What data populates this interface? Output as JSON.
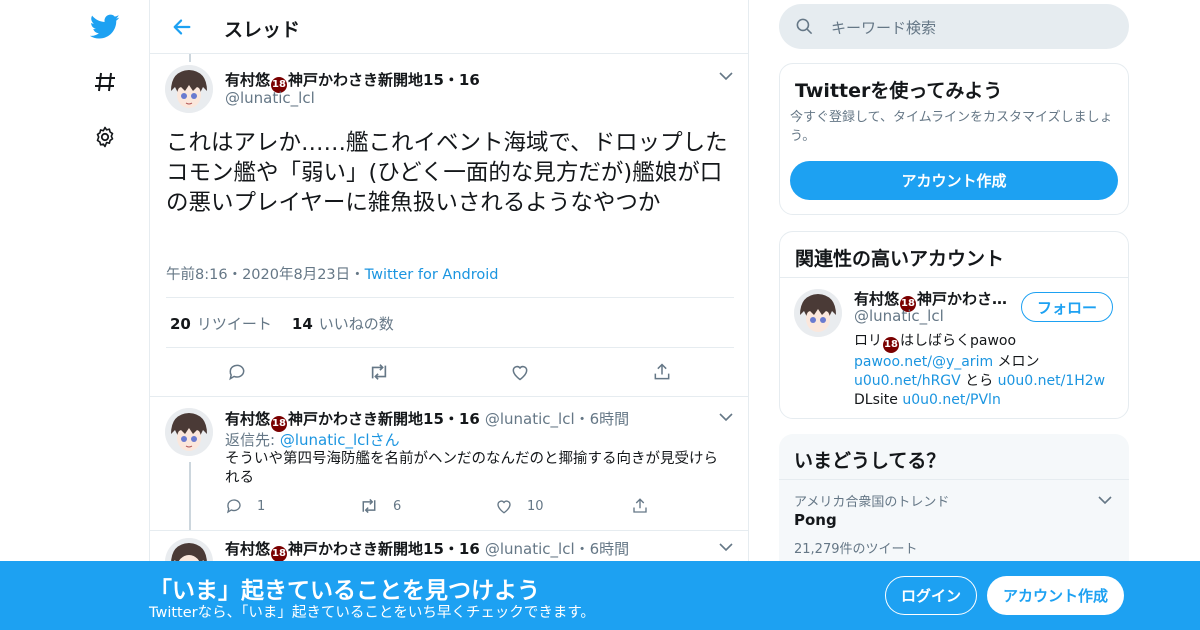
{
  "colors": {
    "accent": "#1da1f2",
    "link": "#1b95e0",
    "muted": "#657786",
    "border": "#e6ecf0"
  },
  "header": {
    "title": "スレッド"
  },
  "nav": {
    "icons": [
      "twitter-logo-icon",
      "hashtag-icon",
      "gear-icon"
    ]
  },
  "main_tweet": {
    "name_pre": "有村悠",
    "badge": "18",
    "name_post": "神戸かわさき新開地15・16",
    "handle": "@lunatic_lcl",
    "text": "これはアレか……艦これイベント海域で、ドロップしたコモン艦や「弱い」(ひどく一面的な見方だが)艦娘が口の悪いプレイヤーに雑魚扱いされるようなやつか",
    "time": "午前8:16",
    "dot1": "・",
    "date": "2020年8月23日",
    "dot2": "・",
    "source": "Twitter for Android",
    "retweets_count": "20",
    "retweets_label": "リツイート",
    "likes_count": "14",
    "likes_label": "いいねの数"
  },
  "replies": [
    {
      "name_pre": "有村悠",
      "badge": "18",
      "name_post": "神戸かわさき新開地15・16",
      "handle": "@lunatic_lcl",
      "dot": "・",
      "time": "6時間",
      "reply_to_label": "返信先: ",
      "reply_to_handle": "@lunatic_lcl",
      "reply_to_suffix": "さん",
      "text": "そういや第四号海防艦を名前がヘンだのなんだのと揶揄する向きが見受けられる",
      "reply_count": "1",
      "retweet_count": "6",
      "like_count": "10"
    },
    {
      "name_pre": "有村悠",
      "badge": "18",
      "name_post": "神戸かわさき新開地15・16",
      "handle": "@lunatic_lcl",
      "dot": "・",
      "time": "6時間"
    }
  ],
  "sidebar": {
    "search_placeholder": "キーワード検索",
    "signup_card": {
      "title": "Twitterを使ってみよう",
      "desc": "今すぐ登録して、タイムラインをカスタマイズしましょう。",
      "button": "アカウント作成"
    },
    "related_card": {
      "title": "関連性の高いアカウント",
      "name_pre": "有村悠",
      "badge": "18",
      "name_post": "神戸かわさ…",
      "handle": "@lunatic_lcl",
      "follow": "フォロー",
      "bio_line1_pre": "ロリ",
      "bio_line1_badge": "18",
      "bio_line1_post": "はしばらくpawoo",
      "bio_link1": "pawoo.net/@y_arim",
      "bio_text1": " メロン",
      "bio_link2": "u0u0.net/hRGV",
      "bio_text2": " とら ",
      "bio_link3": "u0u0.net/1H2w",
      "bio_text3": "DLsite ",
      "bio_link4": "u0u0.net/PVln"
    },
    "trends_card": {
      "title": "いまどうしてる？",
      "trend_context": "アメリカ合衆国のトレンド",
      "trend_name": "Pong",
      "trend_count": "21,279件のツイート"
    }
  },
  "bottom_bar": {
    "title": "「いま」起きていることを見つけよう",
    "subtitle": "Twitterなら、「いま」起きていることをいち早くチェックできます。",
    "login": "ログイン",
    "signup": "アカウント作成"
  }
}
